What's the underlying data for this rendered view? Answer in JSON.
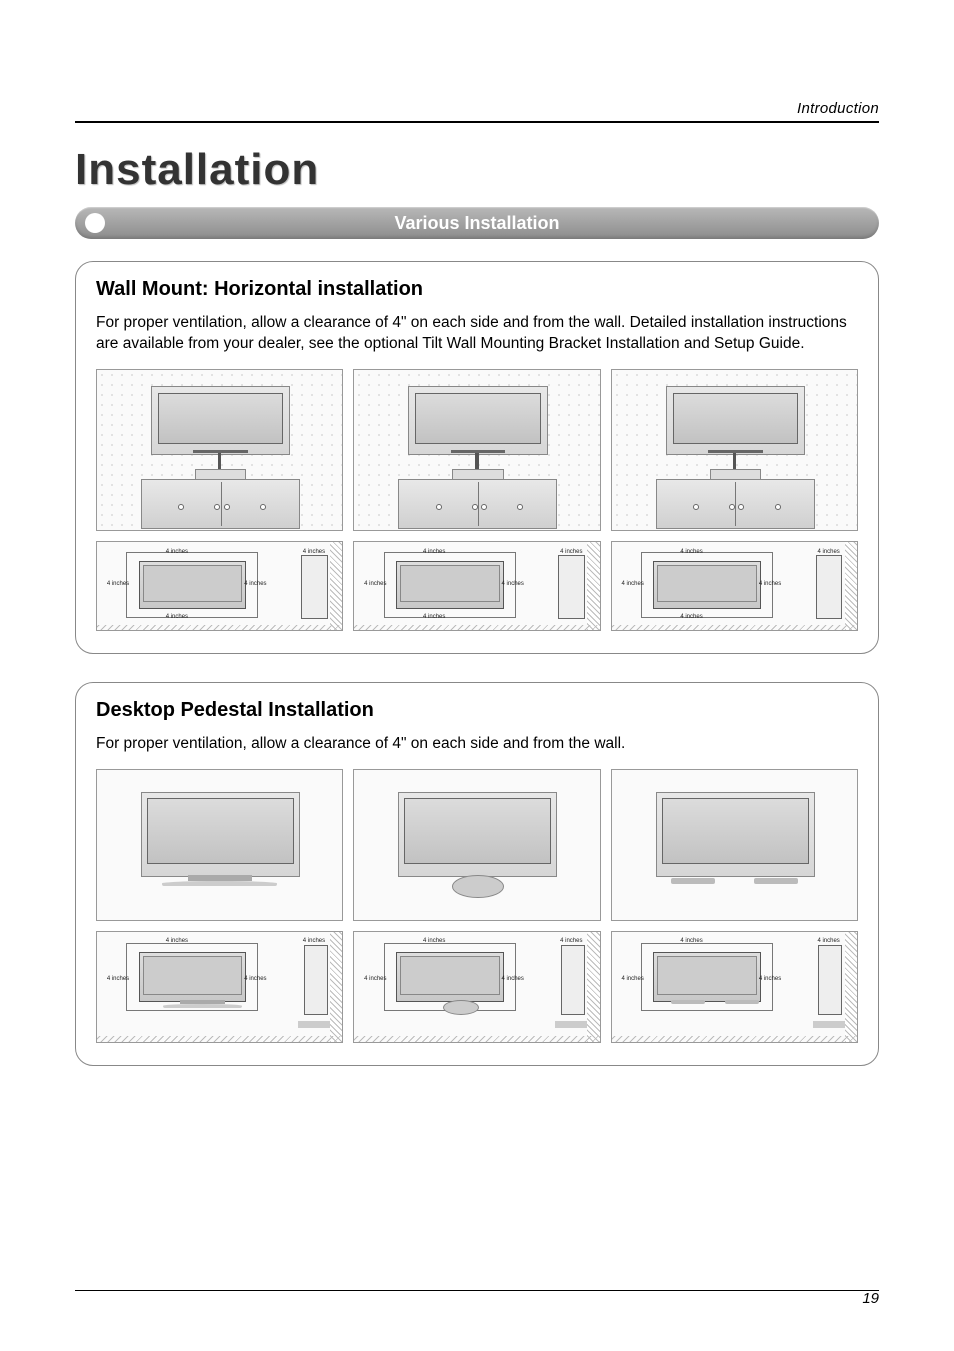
{
  "header": {
    "section": "Introduction",
    "title": "Installation",
    "subtitle": "Various Installation"
  },
  "panels": {
    "wallmount": {
      "title": "Wall Mount: Horizontal installation",
      "text": "For proper ventilation, allow a clearance of 4\" on each side and from the wall. Detailed installation instructions are available from your dealer, see the optional Tilt Wall Mounting Bracket Installation and Setup Guide.",
      "clearance_label": "4 inches"
    },
    "pedestal": {
      "title": "Desktop Pedestal Installation",
      "text": "For proper ventilation, allow a clearance of 4\" on each side and from the wall.",
      "clearance_label": "4 inches"
    }
  },
  "footer": {
    "page_number": "19"
  }
}
